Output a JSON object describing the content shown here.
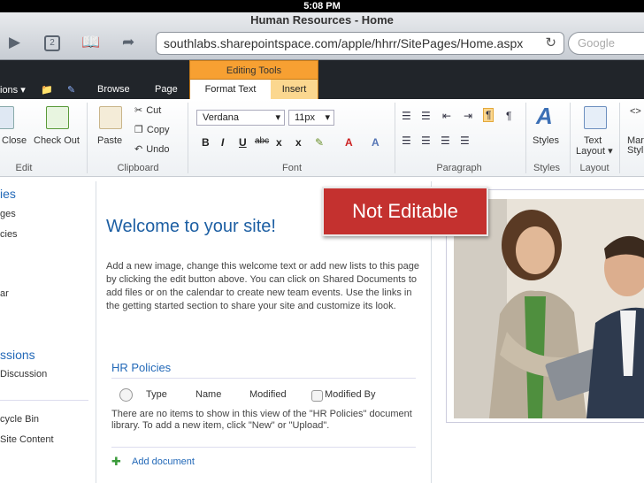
{
  "status_bar": {
    "time": "5:08 PM"
  },
  "browser": {
    "title": "Human Resources - Home",
    "url": "southlabs.sharepointspace.com/apple/hhrr/SitePages/Home.aspx",
    "search_placeholder": "Google",
    "tab_count": "2"
  },
  "ribbon_tabs": {
    "actions": "ions",
    "browse": "Browse",
    "page": "Page",
    "editing_tools": "Editing Tools",
    "format_text": "Format Text",
    "insert": "Insert"
  },
  "ribbon": {
    "edit": {
      "close": "Close",
      "check_out": "Check Out",
      "label": "Edit"
    },
    "clipboard": {
      "paste": "Paste",
      "cut": "Cut",
      "copy": "Copy",
      "undo": "Undo",
      "label": "Clipboard"
    },
    "font": {
      "family": "Verdana",
      "size": "11px",
      "bold": "B",
      "italic": "I",
      "underline": "U",
      "strike": "abc",
      "subscript": "x",
      "superscript": "x",
      "label": "Font"
    },
    "paragraph": {
      "label": "Paragraph"
    },
    "styles": {
      "button": "Styles",
      "label": "Styles"
    },
    "layout": {
      "text_layout_1": "Text",
      "text_layout_2": "Layout",
      "label": "Layout"
    },
    "markup": {
      "line1": "Mar",
      "line2": "Styl"
    }
  },
  "leftnav": {
    "libraries": "ies",
    "site_pages": "ges",
    "policies": "cies",
    "calendar": "ar",
    "discussions": "ssions",
    "team_discussion": "Discussion",
    "recycle_bin": "cycle Bin",
    "all_content": "Site Content"
  },
  "main": {
    "welcome": "Welcome to your site!",
    "intro": "Add a new image, change this welcome text or add new lists to this page by clicking the edit button above. You can click on Shared Documents to add files or on the calendar to create new team events. Use the links in the getting started section to share your site and customize its look.",
    "hr_policies": "HR Policies",
    "columns": {
      "type": "Type",
      "name": "Name",
      "modified": "Modified",
      "modified_by": "Modified By"
    },
    "empty_message": "There are no items to show in this view of the \"HR Policies\" document library. To add a new item, click \"New\" or \"Upload\".",
    "add_document": "Add document"
  },
  "callout": {
    "text": "Not Editable",
    "color": "#c4312f"
  },
  "colors": {
    "accent": "#2369b8",
    "editing_tools": "#f7a032",
    "ribbon_dark": "#21252a"
  }
}
